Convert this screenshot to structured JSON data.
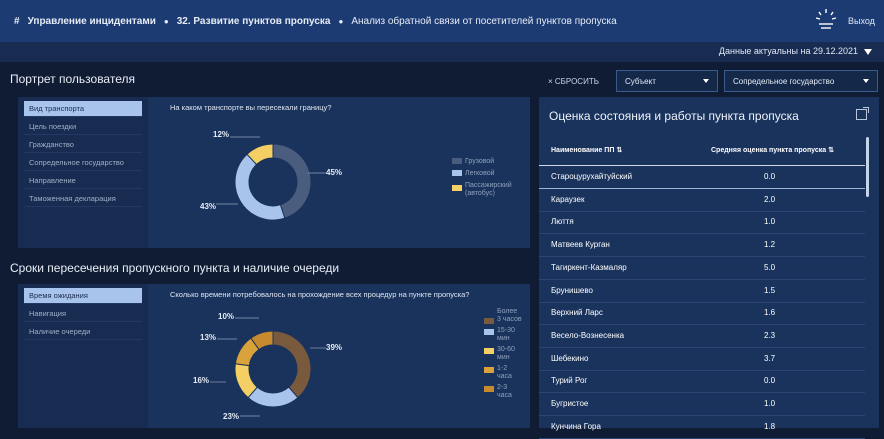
{
  "header": {
    "breadcrumb": [
      "Управление инцидентами",
      "32. Развитие пунктов пропуска",
      "Анализ обратной связи от посетителей пунктов пропуска"
    ],
    "exit_label": "Выход"
  },
  "subbar": {
    "actual": "Данные актуальны на 29.12.2021"
  },
  "portrait": {
    "title": "Портрет пользователя",
    "menu": [
      "Вид транспорта",
      "Цель поездки",
      "Гражданство",
      "Сопредельное государство",
      "Направление",
      "Таможенная декларация"
    ],
    "active": 0,
    "question": "На каком транспорте вы пересекали границу?"
  },
  "timing": {
    "title": "Сроки пересечения пропускного пункта и наличие очереди",
    "menu": [
      "Время ожидания",
      "Навигация",
      "Наличие очереди"
    ],
    "active": 0,
    "question": "Сколько времени потребовалось на прохождение всех процедур на пункте пропуска?"
  },
  "chart_data": [
    {
      "type": "pie",
      "labels": [
        "Грузовой",
        "Легковой",
        "Пассажирский (автобус)"
      ],
      "values": [
        45,
        43,
        12
      ],
      "data_labels": [
        "45%",
        "43%",
        "12%"
      ],
      "colors": [
        "#4b5d7f",
        "#a9c4ec",
        "#f4cf63"
      ]
    },
    {
      "type": "pie",
      "labels": [
        "Более 3 часов",
        "15-30 мин",
        "30-60 мин",
        "1-2 часа",
        "2-3 часа"
      ],
      "values": [
        39,
        23,
        16,
        13,
        10
      ],
      "data_labels": [
        "39%",
        "23%",
        "16%",
        "13%",
        "10%"
      ],
      "colors": [
        "#7a5a3c",
        "#a9c4ec",
        "#f4cf63",
        "#d9a23a",
        "#c78a2e"
      ]
    }
  ],
  "filters": {
    "reset": "× СБРОСИТЬ",
    "subject": "Субъект",
    "country": "Сопредельное государство"
  },
  "table": {
    "title": "Оценка состояния и работы пункта пропуска",
    "col1": "Наименование ПП",
    "col2": "Средняя оценка пункта пропуска",
    "rows": [
      {
        "name": "Староцурухайтуйский",
        "value": "0.0"
      },
      {
        "name": "Караузек",
        "value": "2.0"
      },
      {
        "name": "Люття",
        "value": "1.0"
      },
      {
        "name": "Матвеев Курган",
        "value": "1.2"
      },
      {
        "name": "Тагиркент-Казмаляр",
        "value": "5.0"
      },
      {
        "name": "Брунишево",
        "value": "1.5"
      },
      {
        "name": "Верхний Ларс",
        "value": "1.6"
      },
      {
        "name": "Весело-Вознесенка",
        "value": "2.3"
      },
      {
        "name": "Шебекино",
        "value": "3.7"
      },
      {
        "name": "Турий Рог",
        "value": "0.0"
      },
      {
        "name": "Бугристое",
        "value": "1.0"
      },
      {
        "name": "Кунчина Гора",
        "value": "1.8"
      }
    ]
  }
}
